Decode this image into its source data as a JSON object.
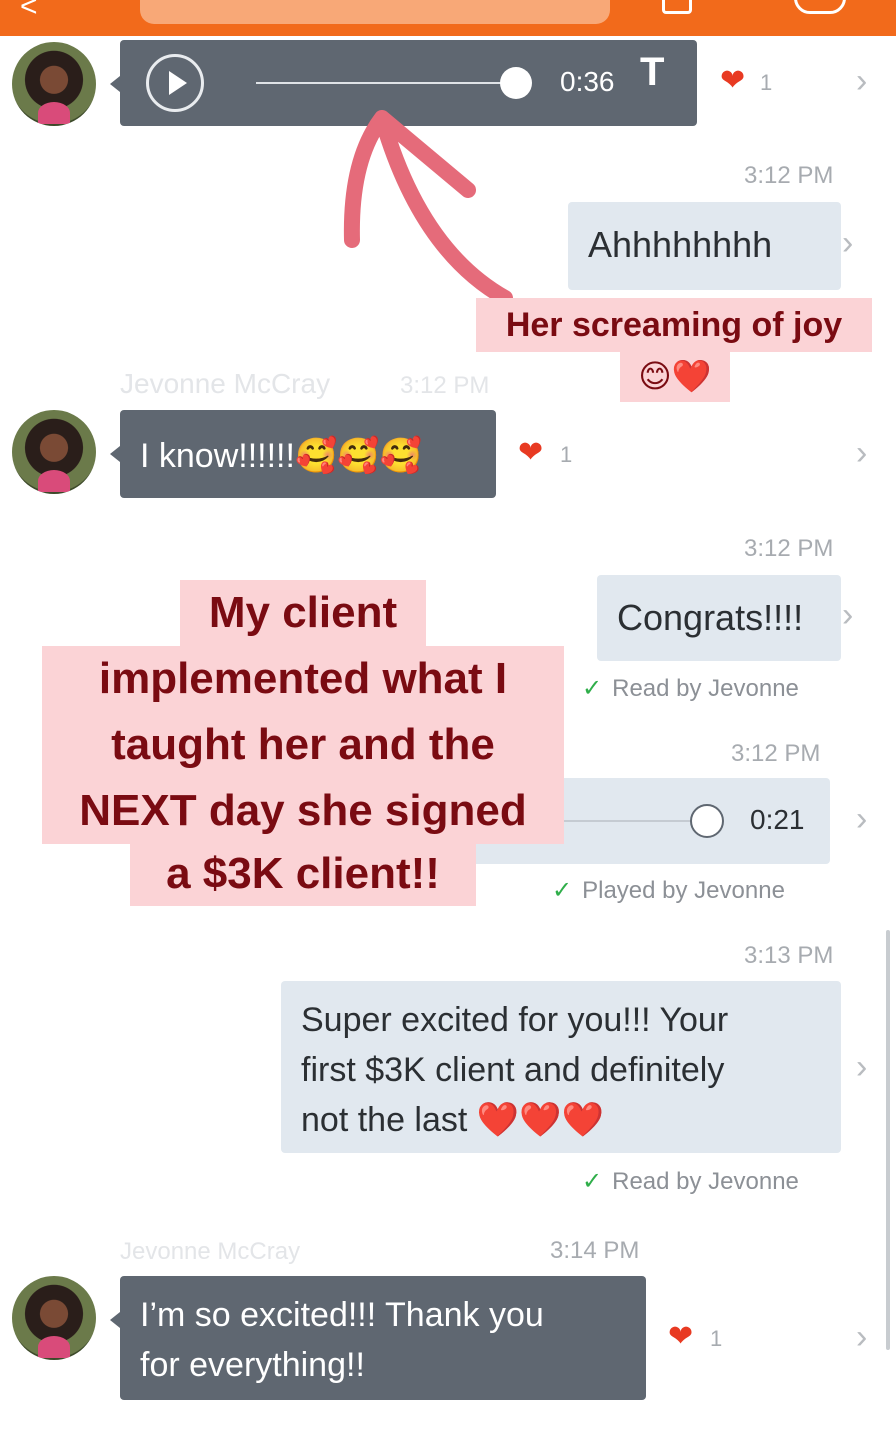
{
  "header": {
    "back_glyph": "<"
  },
  "messages": {
    "m1": {
      "duration": "0:36",
      "likes": "1"
    },
    "m2": {
      "time": "3:12 PM",
      "text": "Ahhhhhhhh"
    },
    "m3": {
      "sender": "Jevonne McCray",
      "time": "3:12 PM",
      "text": "I know!!!!!!",
      "emoji": "🥰🥰🥰",
      "likes": "1"
    },
    "m4": {
      "time": "3:12 PM",
      "text": "Congrats!!!!",
      "status": "Read by Jevonne"
    },
    "m5": {
      "time": "3:12 PM",
      "duration": "0:21",
      "status": "Played by Jevonne"
    },
    "m6": {
      "time": "3:13 PM",
      "line1": "Super excited for you!!! Your",
      "line2": "first $3K client and definitely",
      "line3": "not the last",
      "emoji": "❤️❤️❤️",
      "status": "Read by Jevonne"
    },
    "m7": {
      "sender": "Jevonne McCray",
      "time": "3:14 PM",
      "line1": "I’m so excited!!! Thank you",
      "line2": "for everything!!",
      "likes": "1"
    }
  },
  "annotations": {
    "callout1": "Her screaming of joy",
    "callout1_emoji": "😊❤️",
    "callout2": [
      "My client",
      "implemented what I",
      "taught her and the",
      "NEXT day she signed",
      "a $3K client!!"
    ]
  },
  "icons": {
    "heart": "❤",
    "chevron": "›",
    "check": "✓",
    "transcribe": "T"
  },
  "colors": {
    "header": "#f26a1b",
    "incoming_bubble": "#5f6771",
    "outgoing_bubble": "#e1e8ef",
    "heart": "#e83a22",
    "callout_bg": "#fbd3d6",
    "callout_text": "#7a0b12",
    "arrow": "#e56b7a",
    "check": "#2fae4a"
  }
}
